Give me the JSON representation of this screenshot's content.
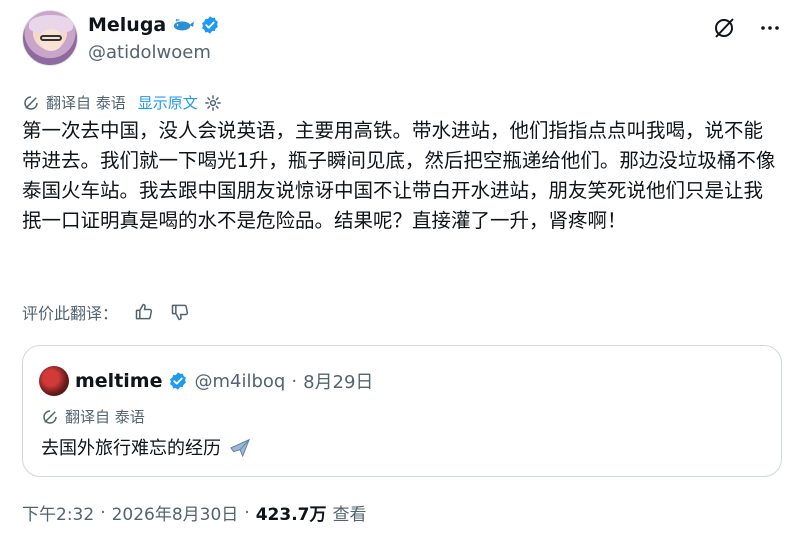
{
  "author": {
    "display_name": "Meluga",
    "handle": "@atidolwoem"
  },
  "translation": {
    "label": "翻译自 泰语",
    "show_original": "显示原文"
  },
  "tweet": {
    "text": "第一次去中国，没人会说英语，主要用高铁。带水进站，他们指指点点叫我喝，说不能带进去。我们就一下喝光1升，瓶子瞬间见底，然后把空瓶递给他们。那边没垃圾桶不像泰国火车站。我去跟中国朋友说惊讶中国不让带白开水进站，朋友笑死说他们只是让我抿一口证明真是喝的水不是危险品。结果呢？直接灌了一升，肾疼啊！"
  },
  "rate": {
    "label": "评价此翻译："
  },
  "quote": {
    "display_name": "meltime",
    "handle": "@m4ilboq",
    "separator": "·",
    "date": "8月29日",
    "translation_label": "翻译自 泰语",
    "text": "去国外旅行难忘的经历"
  },
  "footer": {
    "time": "下午2:32",
    "sep1": "·",
    "date": "2026年8月30日",
    "sep2": "·",
    "views": "423.7万",
    "views_label": "查看"
  },
  "icons": {
    "verified": "verified-badge-icon",
    "whale": "whale-emoji-icon",
    "grok": "grok-icon",
    "more": "more-icon",
    "translate": "translate-icon",
    "settings": "gear-icon",
    "thumb_up": "thumbs-up-icon",
    "thumb_down": "thumbs-down-icon",
    "plane": "airplane-emoji-icon"
  },
  "colors": {
    "accent": "#1d9bf0",
    "text": "#0f1419",
    "muted": "#536471"
  }
}
